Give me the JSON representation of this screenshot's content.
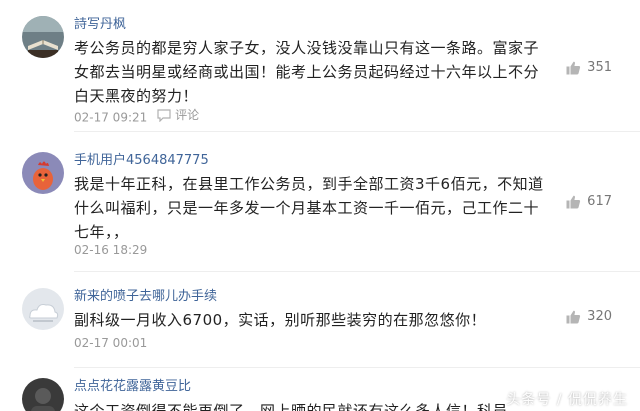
{
  "comments": [
    {
      "username": "詩写丹枫",
      "text": "考公务员的都是穷人家子女，没人没钱没靠山只有这一条路。富家子女都去当明星或经商或出国！能考上公务员起码经过十六年以上不分白天黑夜的努力！",
      "time": "02-17 09:21",
      "reply_label": "评论",
      "likes": "351",
      "avatar_icon": "book-avatar-icon"
    },
    {
      "username": "手机用户4564847775",
      "text": "我是十年正科，在县里工作公务员，到手全部工资3千6佰元，不知道什么叫福利，只是一年多发一个月基本工资一千一佰元，己工作二十七年，，",
      "time": "02-16 18:29",
      "likes": "617",
      "avatar_icon": "rooster-avatar-icon"
    },
    {
      "username": "新来的喷子去哪儿办手续",
      "text": "副科级一月收入6700，实话，别听那些装穷的在那忽悠你！",
      "time": "02-17 00:01",
      "likes": "320",
      "avatar_icon": "cloud-avatar-icon"
    },
    {
      "username": "点点花花露露黄豆比",
      "text": "这个工资倒得不能再倒了，网上晒的民就还有这么多人信！科员",
      "avatar_icon": "dark-avatar-icon"
    }
  ],
  "watermark": "头条号 / 侃侃养生"
}
